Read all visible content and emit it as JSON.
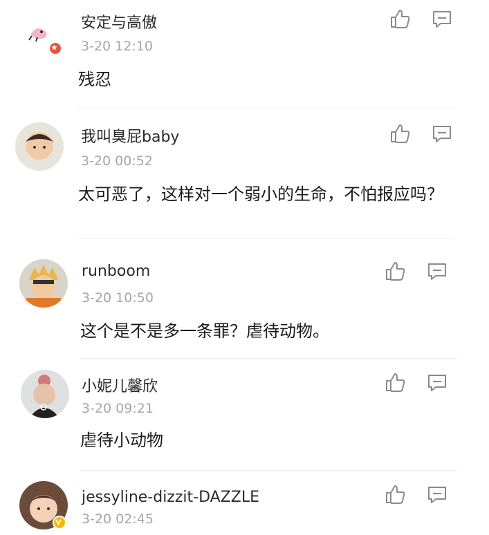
{
  "comments": [
    {
      "username": "安定与高傲",
      "timestamp": "3-20 12:10",
      "text": "残忍",
      "badge": "red-star",
      "badge_color": "#e9533a"
    },
    {
      "username": "我叫臭屁baby",
      "timestamp": "3-20 00:52",
      "text": "太可恶了，这样对一个弱小的生命，不怕报应吗？"
    },
    {
      "username": "runboom",
      "timestamp": "3-20 10:50",
      "text": "这个是不是多一条罪？虐待动物。"
    },
    {
      "username": "小妮儿馨欣",
      "timestamp": "3-20 09:21",
      "text": "虐待小动物"
    },
    {
      "username": "jessyline-dizzit-DAZZLE",
      "timestamp": "3-20 02:45",
      "text": "",
      "badge": "verified-v",
      "badge_color": "#f5b800"
    }
  ],
  "icons": {
    "like": "thumbs-up-icon",
    "reply": "comment-icon"
  }
}
